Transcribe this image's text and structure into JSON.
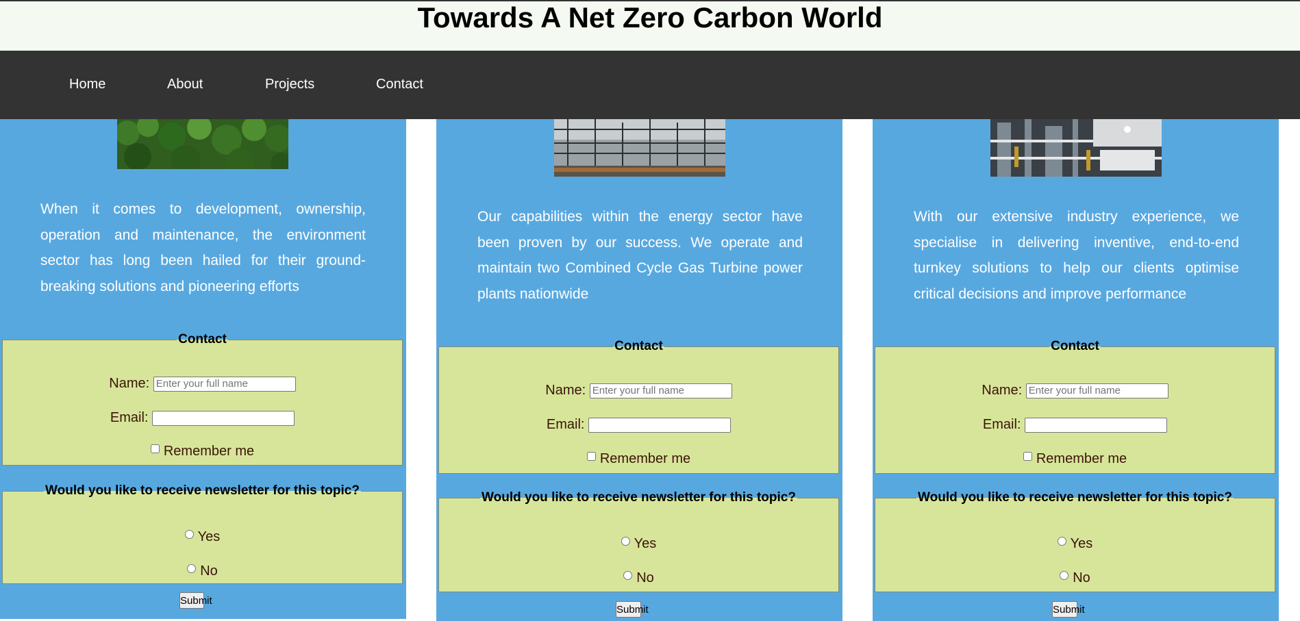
{
  "header": {
    "title": "Towards A Net Zero Carbon World"
  },
  "nav": {
    "items": [
      "Home",
      "About",
      "Projects",
      "Contact"
    ]
  },
  "cards": [
    {
      "image_icon": "forest-photo",
      "description": "When it comes to development, ownership, operation and maintenance, the environment sector has long been hailed for their ground-breaking solutions and pioneering efforts",
      "contact": {
        "legend": "Contact",
        "name_label": "Name:",
        "name_placeholder": "Enter your full name",
        "email_label": "Email:",
        "remember_label": "Remember me"
      },
      "newsletter": {
        "legend": "Would you like to receive newsletter for this topic?",
        "yes": "Yes",
        "no": "No"
      },
      "submit_label": "Submit"
    },
    {
      "image_icon": "power-substation-photo",
      "description": "Our capabilities within the energy sector have been proven by our success. We operate and maintain two Combined Cycle Gas Turbine power plants nationwide",
      "contact": {
        "legend": "Contact",
        "name_label": "Name:",
        "name_placeholder": "Enter your full name",
        "email_label": "Email:",
        "remember_label": "Remember me"
      },
      "newsletter": {
        "legend": "Would you like to receive newsletter for this topic?",
        "yes": "Yes",
        "no": "No"
      },
      "submit_label": "Submit"
    },
    {
      "image_icon": "industrial-plant-photo",
      "description": "With our extensive industry experience, we specialise in delivering inventive, end-to-end turnkey solutions to help our clients optimise critical decisions and improve performance",
      "contact": {
        "legend": "Contact",
        "name_label": "Name:",
        "name_placeholder": "Enter your full name",
        "email_label": "Email:",
        "remember_label": "Remember me"
      },
      "newsletter": {
        "legend": "Would you like to receive newsletter for this topic?",
        "yes": "Yes",
        "no": "No"
      },
      "submit_label": "Submit"
    }
  ],
  "colors": {
    "header_bg": "#f4f9f1",
    "nav_bg": "#333333",
    "card_bg": "#58a8e0",
    "form_bg": "#d7e59b",
    "label_text": "#3a1506"
  }
}
